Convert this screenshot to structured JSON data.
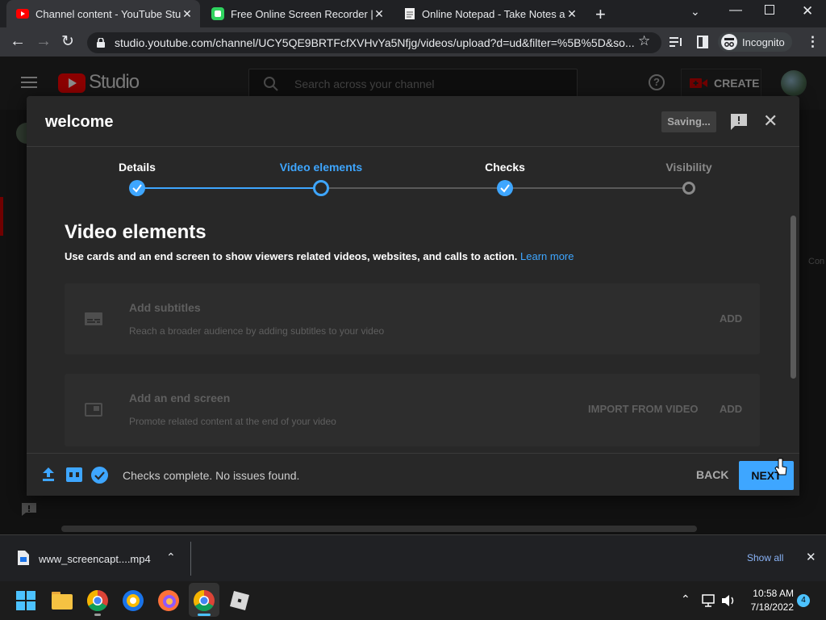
{
  "browser": {
    "tabs": [
      {
        "title": "Channel content - YouTube Studio",
        "active": true
      },
      {
        "title": "Free Online Screen Recorder | Online",
        "active": false
      },
      {
        "title": "Online Notepad - Take Notes and",
        "active": false
      }
    ],
    "url": "studio.youtube.com/channel/UCY5QE9BRTFcfXVHvYa5Nfjg/videos/upload?d=ud&filter=%5B%5D&so...",
    "profile_label": "Incognito"
  },
  "studio": {
    "logo": "Studio",
    "search_placeholder": "Search across your channel",
    "create_label": "CREATE",
    "side_partial": "Con"
  },
  "dialog": {
    "title": "welcome",
    "saving_label": "Saving...",
    "steps": [
      {
        "label": "Details",
        "state": "done"
      },
      {
        "label": "Video elements",
        "state": "current"
      },
      {
        "label": "Checks",
        "state": "done"
      },
      {
        "label": "Visibility",
        "state": "pending"
      }
    ],
    "heading": "Video elements",
    "description": "Use cards and an end screen to show viewers related videos, websites, and calls to action.",
    "learn_more": "Learn more",
    "cards": [
      {
        "title": "Add subtitles",
        "subtitle": "Reach a broader audience by adding subtitles to your video",
        "add_label": "ADD"
      },
      {
        "title": "Add an end screen",
        "subtitle": "Promote related content at the end of your video",
        "import_label": "IMPORT FROM VIDEO",
        "add_label": "ADD"
      }
    ],
    "footer_status": "Checks complete. No issues found.",
    "back_label": "BACK",
    "next_label": "NEXT"
  },
  "download": {
    "filename": "www_screencapt....mp4",
    "show_all": "Show all"
  },
  "taskbar": {
    "time": "10:58 AM",
    "date": "7/18/2022",
    "notifications": "4"
  },
  "colors": {
    "accent": "#3ea6ff",
    "youtube_red": "#ff0000",
    "create_red": "#cc0000"
  }
}
